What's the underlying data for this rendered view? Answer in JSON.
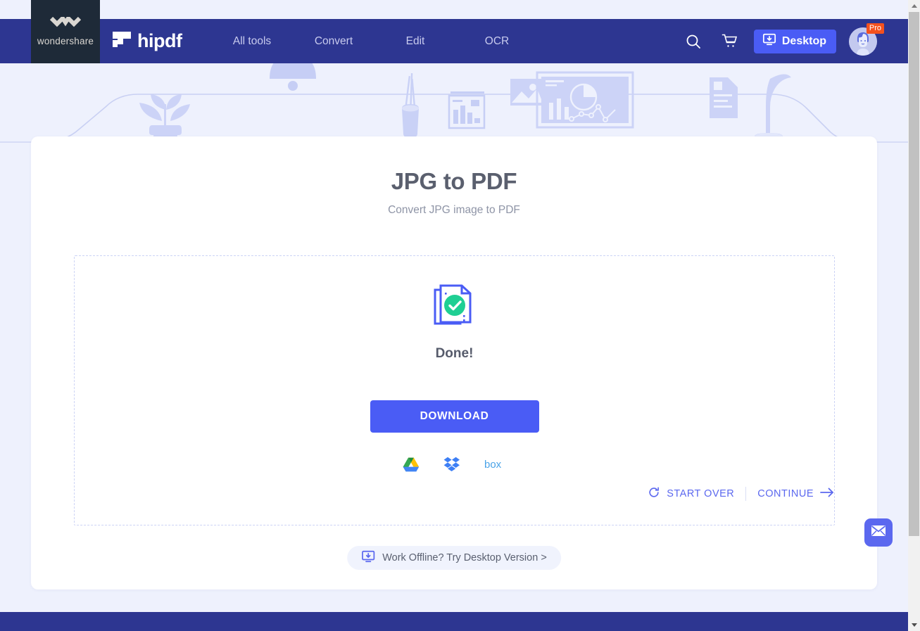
{
  "header": {
    "wondershare_label": "wondershare",
    "brand_name": "hipdf",
    "nav": [
      {
        "label": "All tools"
      },
      {
        "label": "Convert"
      },
      {
        "label": "Edit"
      },
      {
        "label": "OCR"
      }
    ],
    "search_icon": "search-icon",
    "cart_icon": "cart-icon",
    "desktop_button": "Desktop",
    "pro_badge": "Pro",
    "colors": {
      "bar": "#2d3691",
      "accent": "#4a5cf5",
      "pro": "#f4511e",
      "wondershare_block": "#1e2a38"
    }
  },
  "main": {
    "title": "JPG to PDF",
    "subtitle": "Convert JPG image to PDF",
    "status_text": "Done!",
    "download_button": "DOWNLOAD",
    "cloud_targets": [
      {
        "name": "google-drive",
        "label": "Google Drive"
      },
      {
        "name": "dropbox",
        "label": "Dropbox"
      },
      {
        "name": "box",
        "label": "box"
      }
    ],
    "start_over": "START OVER",
    "continue": "CONTINUE",
    "offline_cta": "Work Offline? Try Desktop Version >"
  },
  "widgets": {
    "email_icon": "envelope-icon"
  },
  "scrollbar": {
    "up_arrow": "scroll-up",
    "down_arrow": "scroll-down"
  }
}
